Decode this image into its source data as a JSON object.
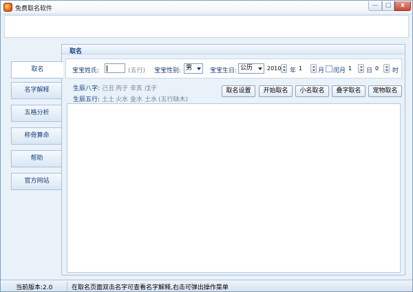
{
  "window": {
    "title": "免费取名软件",
    "controls": {
      "minimize": "—",
      "maximize": "□",
      "close": "x"
    }
  },
  "nav": {
    "items": [
      {
        "label": "取名",
        "active": true
      },
      {
        "label": "名字解释"
      },
      {
        "label": "五格分析"
      },
      {
        "label": "称骨算命"
      },
      {
        "label": "帮助"
      },
      {
        "label": "官方网站"
      }
    ]
  },
  "panel": {
    "title": "取名",
    "form": {
      "surname_label": "宝宝姓氏:",
      "surname_value": "",
      "wuxing_hint": "(五行)",
      "gender_label": "宝宝性别:",
      "gender_value": "男",
      "birthday_label": "宝宝生日:",
      "calendar_value": "公历",
      "year_value": "2010",
      "year_unit": "年",
      "month_value": "1",
      "month_unit": "月",
      "leap_month_label": "闰月",
      "day_value": "1",
      "day_unit": "日",
      "hour_value": "0",
      "hour_unit": "时"
    },
    "bazi": {
      "label": "生辰八字:",
      "values": [
        "己丑",
        "丙子",
        "辛亥",
        "戊子"
      ]
    },
    "wuxing": {
      "label": "生辰五行:",
      "values": [
        "土土",
        "火水",
        "金水",
        "土水"
      ],
      "note": "(五行缺木)"
    },
    "buttons": {
      "settings": "取名设置",
      "start": "开始取名",
      "nickname": "小名取名",
      "double": "叠字取名",
      "pet": "宠物取名"
    }
  },
  "status": {
    "version": "当前版本:2.0",
    "tip": "在取名页面双击名字可查看名字解释,右击可弹出操作菜单"
  }
}
